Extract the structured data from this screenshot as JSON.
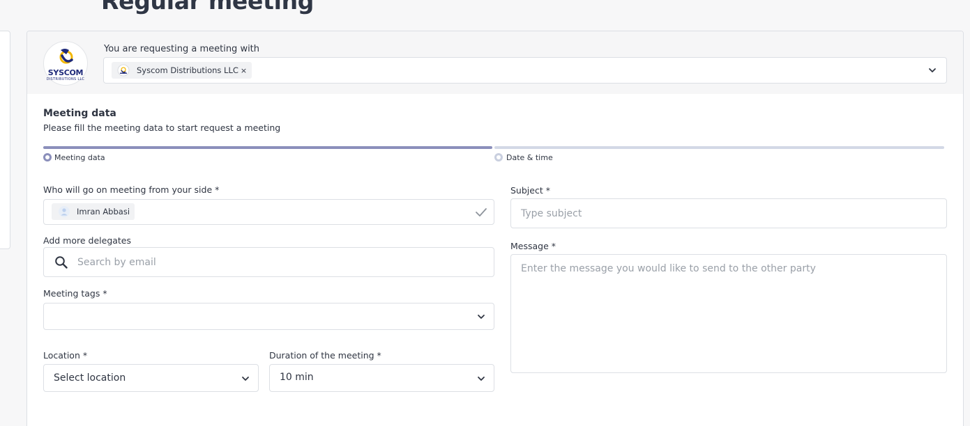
{
  "page": {
    "title": "Regular meeting"
  },
  "request": {
    "label": "You are requesting a meeting with",
    "company": {
      "logo_text": "SYSCOM",
      "logo_sub": "DISTRIBUTIONS LLC",
      "chip_label": "Syscom Distributions LLC",
      "remove_glyph": "×"
    }
  },
  "section": {
    "title": "Meeting data",
    "subtitle": "Please fill the meeting data to start request a meeting"
  },
  "steps": [
    {
      "label": "Meeting data",
      "active": true
    },
    {
      "label": "Date & time",
      "active": false
    }
  ],
  "form": {
    "attendee": {
      "label": "Who will go on meeting from your side *",
      "selected": "Imran Abbasi"
    },
    "delegates": {
      "label": "Add more delegates",
      "placeholder": "Search by email"
    },
    "tags": {
      "label": "Meeting tags *",
      "value": ""
    },
    "location": {
      "label": "Location *",
      "value": "Select location"
    },
    "duration": {
      "label": "Duration of the meeting *",
      "value": "10 min"
    },
    "subject": {
      "label": "Subject *",
      "placeholder": "Type subject"
    },
    "message": {
      "label": "Message *",
      "placeholder": "Enter the message you would like to send to the other party"
    }
  },
  "colors": {
    "step_active": "#8b8fbb",
    "step_inactive": "#d3d8e6",
    "brand_blue": "#1f2a7a",
    "brand_yellow": "#f2b705"
  }
}
